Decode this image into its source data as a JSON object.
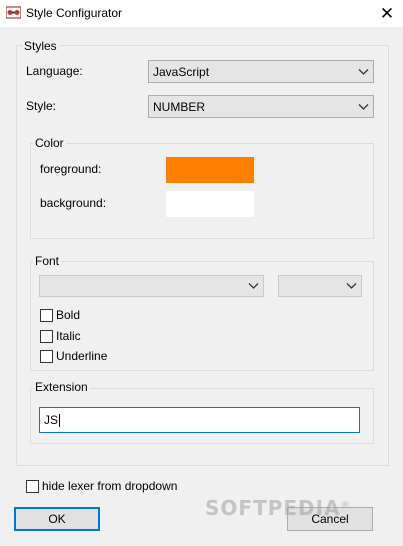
{
  "window": {
    "title": "Style Configurator",
    "icon": "app-icon",
    "close_glyph": "✕"
  },
  "styles_group": {
    "legend": "Styles",
    "language_label": "Language:",
    "language_value": "JavaScript",
    "style_label": "Style:",
    "style_value": "NUMBER"
  },
  "color_group": {
    "legend": "Color",
    "foreground_label": "foreground:",
    "foreground_color": "#ff8000",
    "background_label": "background:",
    "background_color": "#ffffff"
  },
  "font_group": {
    "legend": "Font",
    "font_name_value": "",
    "font_size_value": "",
    "bold_label": "Bold",
    "bold_checked": false,
    "italic_label": "Italic",
    "italic_checked": false,
    "underline_label": "Underline",
    "underline_checked": false
  },
  "extension_group": {
    "legend": "Extension",
    "value": "JS"
  },
  "footer": {
    "hide_lexer_label": "hide lexer from dropdown",
    "hide_lexer_checked": false,
    "ok_label": "OK",
    "cancel_label": "Cancel"
  },
  "watermark": {
    "text": "SOFTPEDIA",
    "mark": "®"
  },
  "colors": {
    "accent": "#0078d7",
    "window_bg": "#f0f0f0"
  }
}
